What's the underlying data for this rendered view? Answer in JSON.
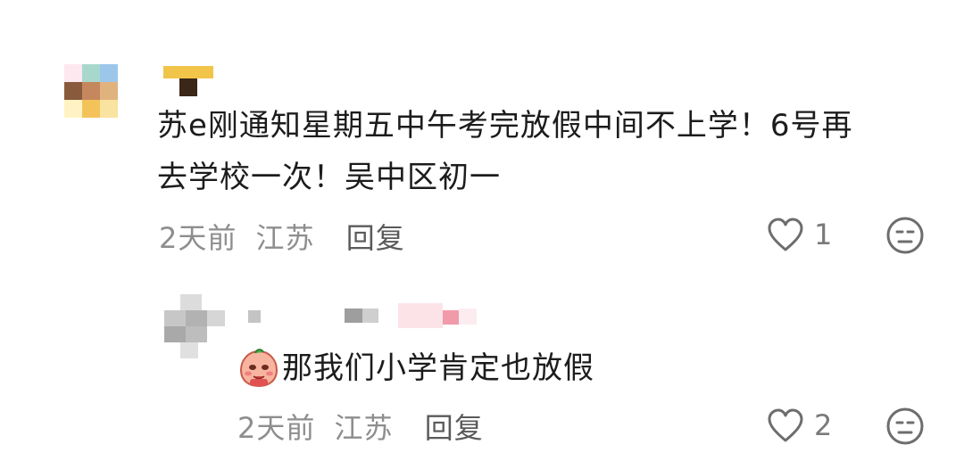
{
  "comments": [
    {
      "text_line1": "苏e刚通知星期五中午考完放假中间不上学！6号再",
      "text_line2": "去学校一次！吴中区初一",
      "time": "2天前",
      "location": "江苏",
      "reply_label": "回复",
      "like_count": "1",
      "like_icon": "heart-outline",
      "dislike_icon": "neutral-face"
    },
    {
      "sticker": "peach-emoji-sticker",
      "text": "那我们小学肯定也放假",
      "time": "2天前",
      "location": "江苏",
      "reply_label": "回复",
      "like_count": "2",
      "like_icon": "heart-outline",
      "dislike_icon": "neutral-face"
    }
  ],
  "colors": {
    "text": "#1c1c1c",
    "meta": "#8e8e8e",
    "icon": "#6d6d6d"
  }
}
